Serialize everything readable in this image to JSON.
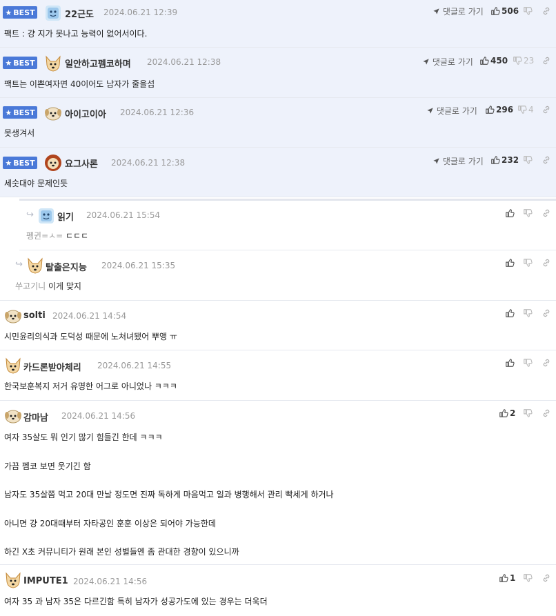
{
  "goto_label": "댓글로 가기",
  "best_label": "BEST",
  "colors": {
    "best_badge": "#4a79d8",
    "best_bg": "#eef2fb"
  },
  "comments": [
    {
      "nick": "22근도",
      "date": "2024.06.21 12:39",
      "text": "팩트 : 걍 지가 못나고 능력이 없어서이다.",
      "likes": "506",
      "dislikes": "",
      "best": true,
      "avatar": "ice-avatar"
    },
    {
      "nick": "일안하고펨코하며",
      "date": "2024.06.21 12:38",
      "text": "팩트는 이쁜여자면 40이어도 남자가 줄을섬",
      "likes": "450",
      "dislikes": "23",
      "best": true,
      "avatar": "dog-avatar"
    },
    {
      "nick": "아이고이아",
      "date": "2024.06.21 12:36",
      "text": "못생겨서",
      "likes": "296",
      "dislikes": "4",
      "best": true,
      "avatar": "puppy-avatar"
    },
    {
      "nick": "요그사론",
      "date": "2024.06.21 12:38",
      "text": "세숫대야 문제인듯",
      "likes": "232",
      "dislikes": "",
      "best": true,
      "avatar": "lion-avatar"
    },
    {
      "nick": "읽기",
      "date": "2024.06.21 15:54",
      "text_prefix": "펭귄=ㅅ= ",
      "text": "ㄷㄷㄷ",
      "likes": "",
      "dislikes": "",
      "best": false,
      "avatar": "ice-avatar"
    },
    {
      "nick": "탈출은지능",
      "date": "2024.06.21 15:35",
      "text_prefix": "쑤고기니 ",
      "text": "이게 맞지",
      "likes": "",
      "dislikes": "",
      "best": false,
      "avatar": "dog-avatar"
    },
    {
      "nick": "solti",
      "date": "2024.06.21 14:54",
      "text": "시민윤리의식과 도덕성 때문에 노처녀됐어 뿌앵 ㅠ",
      "likes": "",
      "dislikes": "",
      "best": false,
      "avatar": "puppy-avatar"
    },
    {
      "nick": "카드론받아체리",
      "date": "2024.06.21 14:55",
      "text": "한국보훈복지 저거 유명한 어그로 아니었나 ㅋㅋㅋ",
      "likes": "",
      "dislikes": "",
      "best": false,
      "avatar": "dog-avatar"
    },
    {
      "nick": "감마남",
      "date": "2024.06.21 14:56",
      "lines": [
        "여자 35살도 뭐 인기 많기 힘들긴 한데 ㅋㅋㅋ",
        "가끔 펨코 보면 웃기긴 함",
        "남자도 35살쯤 먹고 20대 만날 정도면 진짜 독하게 마음먹고 일과 병행해서 관리 빡세게 하거나",
        "아니면 걍 20대때부터 자타공인 훈훈 이상은 되어야 가능한데",
        "하긴 X초 커뮤니티가 원래 본인 성별들엔 좀 관대한 경향이 있으니까"
      ],
      "likes": "2",
      "dislikes": "",
      "best": false,
      "avatar": "puppy-avatar"
    },
    {
      "nick": "IMPUTE1",
      "date": "2024.06.21 14:56",
      "text": "여자 35 과 남자 35은 다르긴함 특히 남자가 성공가도에 있는 경우는 더욱더",
      "likes": "1",
      "dislikes": "",
      "best": false,
      "avatar": "dog-avatar"
    }
  ]
}
